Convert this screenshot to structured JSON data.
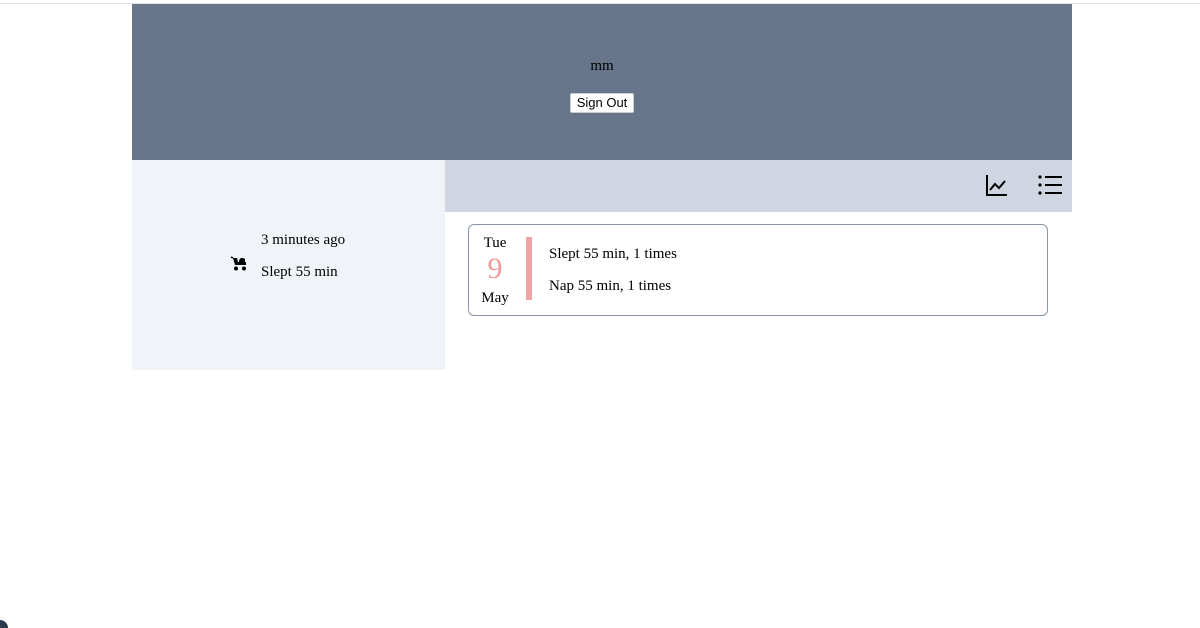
{
  "header": {
    "username": "mm",
    "signout_label": "Sign Out"
  },
  "sidebar": {
    "last_time": "3 minutes ago",
    "last_sleep": "Slept 55 min",
    "icon": "stroller-icon"
  },
  "toolbar": {
    "icons": [
      "chart-icon",
      "list-icon"
    ]
  },
  "day_card": {
    "weekday": "Tue",
    "day": "9",
    "month": "May",
    "summary": "Slept 55 min, 1 times",
    "nap": "Nap 55 min, 1 times",
    "accent_color": "#f19a9a"
  },
  "colors": {
    "header_bg": "#667589",
    "sidebar_bg": "#f0f4f8",
    "toolbar_bg": "#cfd6e1"
  }
}
